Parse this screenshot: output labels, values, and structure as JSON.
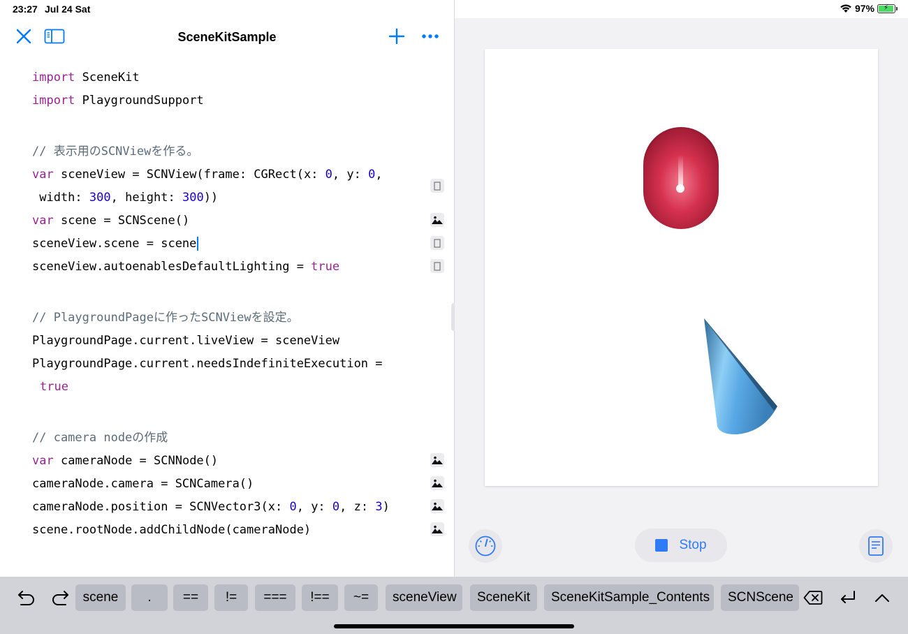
{
  "status_bar": {
    "time": "23:27",
    "date": "Jul 24 Sat",
    "battery_percent": "97%",
    "battery_level": 0.97
  },
  "nav": {
    "title": "SceneKitSample",
    "close_icon": "close-icon",
    "sidebar_icon": "sidebar-icon",
    "add_icon": "plus-icon",
    "more_icon": "more-icon"
  },
  "colors": {
    "accent": "#007aff",
    "keyword": "#9b2393",
    "number": "#1c00cf",
    "comment": "#5d6c79",
    "object_red": "#d6314e",
    "object_blue": "#5aa9e6"
  },
  "code": {
    "l1": "SceneKit",
    "l2": "PlaygroundSupport",
    "l3": "// 表示用のSCNViewを作る。",
    "l4a": "sceneView = SCNView(frame: CGRect(x: ",
    "l4b": "0",
    "l4c": ", y: ",
    "l4d": "0",
    "l4e": ",",
    "l5a": " width: ",
    "l5b": "300",
    "l5c": ", height: ",
    "l5d": "300",
    "l5e": "))",
    "l6": "scene = SCNScene()",
    "l7": "sceneView.scene = scene",
    "l8a": "sceneView.autoenablesDefaultLighting = ",
    "l8b": "true",
    "l9": "// PlaygroundPageに作ったSCNViewを設定。",
    "l10": "PlaygroundPage.current.liveView = sceneView",
    "l11": "PlaygroundPage.current.needsIndefiniteExecution =",
    "l12": "true",
    "l13": "// camera nodeの作成",
    "l14": "cameraNode = SCNNode()",
    "l15": "cameraNode.camera = SCNCamera()",
    "l16a": "cameraNode.position = SCNVector3(x: ",
    "l16b": "0",
    "l16c": ", y: ",
    "l16d": "0",
    "l16e": ", z: ",
    "l16f": "3",
    "l16g": ")",
    "l17": "scene.rootNode.addChildNode(cameraNode)",
    "kw_import": "import",
    "kw_var": "var"
  },
  "live_view": {
    "stop_label": "Stop",
    "metrics_icon": "gauge-icon",
    "doc_icon": "document-icon"
  },
  "shortcut_bar": {
    "undo_icon": "undo-icon",
    "redo_icon": "redo-icon",
    "keys": [
      "scene",
      ".",
      "==",
      "!=",
      "===",
      "!==",
      "~=",
      "sceneView",
      "SceneKit",
      "SceneKitSample_Contents",
      "SCNScene"
    ],
    "delete_icon": "delete-icon",
    "return_icon": "return-icon",
    "collapse_icon": "chevron-up-icon"
  }
}
